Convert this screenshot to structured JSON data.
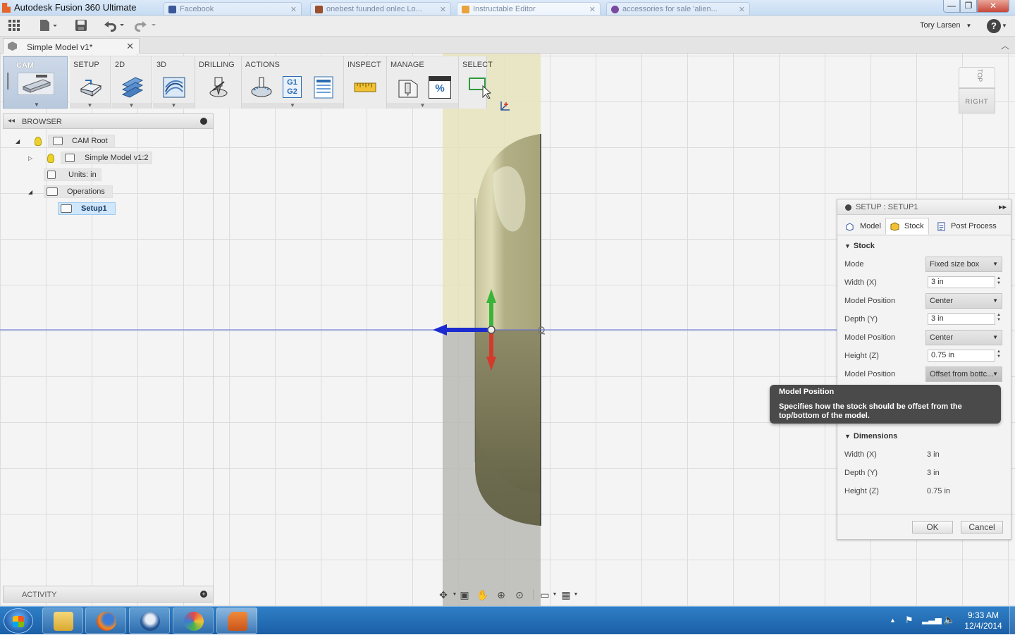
{
  "window": {
    "title": "Autodesk Fusion 360 Ultimate",
    "browser_tabs": [
      {
        "label": "Facebook",
        "color": "#3b5998"
      },
      {
        "label": "onebest fuunded onlec Lo...",
        "color": "#9b4f2c"
      },
      {
        "label": "Instructable Editor",
        "color": "#e9a33a"
      },
      {
        "label": "accessories for sale 'alien...",
        "color": "#7a4aa0"
      }
    ],
    "controls": {
      "minimize": "—",
      "maximize": "❐",
      "close": "✕"
    }
  },
  "quick_access": {
    "user_name": "Tory Larsen",
    "help_label": "?"
  },
  "document": {
    "tab_name": "Simple Model v1*"
  },
  "ribbon": {
    "workspace": "CAM",
    "groups": [
      {
        "label": "SETUP"
      },
      {
        "label": "2D"
      },
      {
        "label": "3D"
      },
      {
        "label": "DRILLING"
      },
      {
        "label": "ACTIONS"
      },
      {
        "label": "INSPECT"
      },
      {
        "label": "MANAGE"
      },
      {
        "label": "SELECT"
      }
    ],
    "g1g2_text": "G1\nG2",
    "percent_text": "%"
  },
  "browser": {
    "title": "BROWSER",
    "nodes": {
      "cam_root": "CAM Root",
      "model": "Simple Model v1:2",
      "units": "Units: in",
      "operations": "Operations",
      "setup1": "Setup1"
    },
    "activity_label": "ACTIVITY"
  },
  "viewcube": {
    "top": "TOP",
    "front": "RIGHT"
  },
  "setup_dialog": {
    "title": "SETUP : SETUP1",
    "tabs": [
      "Model",
      "Stock",
      "Post Process"
    ],
    "active_tab": "Stock",
    "stock_section": "Stock",
    "rows": {
      "mode_label": "Mode",
      "mode_value": "Fixed size box",
      "width_label": "Width (X)",
      "width_value": "3 in",
      "pos1_label": "Model Position",
      "pos1_value": "Center",
      "depth_label": "Depth (Y)",
      "depth_value": "3 in",
      "pos2_label": "Model Position",
      "pos2_value": "Center",
      "height_label": "Height (Z)",
      "height_value": "0.75 in",
      "pos3_label": "Model Position",
      "pos3_value": "Offset from bottc..."
    },
    "dimensions_section": "Dimensions",
    "dims": {
      "width_label": "Width (X)",
      "width_value": "3 in",
      "depth_label": "Depth (Y)",
      "depth_value": "3 in",
      "height_label": "Height (Z)",
      "height_value": "0.75 in"
    },
    "ok_label": "OK",
    "cancel_label": "Cancel"
  },
  "tooltip": {
    "title": "Model Position",
    "body": "Specifies how the stock should be offset from the top/bottom of the model."
  },
  "taskbar": {
    "apps": [
      "file-explorer",
      "firefox",
      "thunderbird",
      "paint",
      "fusion-360"
    ],
    "time": "9:33 AM",
    "date": "12/4/2014"
  },
  "colors": {
    "axis_x": "#1b2bd0",
    "axis_y": "#3ab53a",
    "axis_z": "#d33a2c",
    "stock_box": "#e3e0b8",
    "model_surface": "#8a8766",
    "selection": "#cfe6fb"
  }
}
